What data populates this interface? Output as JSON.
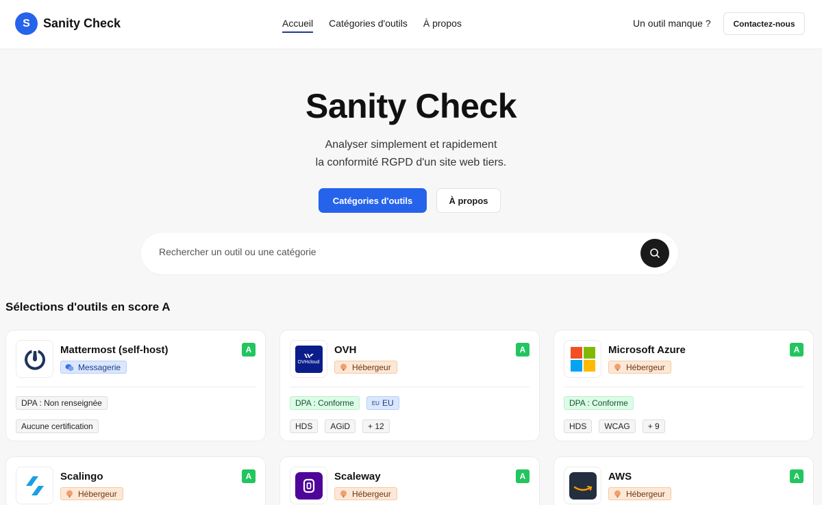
{
  "header": {
    "brand_initial": "S",
    "brand_name": "Sanity Check",
    "nav": [
      "Accueil",
      "Catégories d'outils",
      "À propos"
    ],
    "missing_tool": "Un outil manque ?",
    "contact_button": "Contactez-nous"
  },
  "hero": {
    "title": "Sanity Check",
    "subtitle_line1": "Analyser simplement et rapidement",
    "subtitle_line2": "la conformité RGPD d'un site web tiers.",
    "primary_button": "Catégories d'outils",
    "secondary_button": "À propos"
  },
  "search": {
    "placeholder": "Rechercher un outil ou une catégorie"
  },
  "section_title": "Sélections d'outils en score A",
  "colors": {
    "accent": "#2563eb",
    "score_a": "#22c55e",
    "dark": "#1a1a1a"
  },
  "cards": [
    {
      "name": "Mattermost (self-host)",
      "category": "Messagerie",
      "category_icon": "chat-bubbles-icon",
      "logo": "mattermost-logo",
      "score": "A",
      "chips_row1": [
        "DPA : Non renseignée"
      ],
      "chips_row2": [
        "Aucune certification"
      ]
    },
    {
      "name": "OVH",
      "category": "Hébergeur",
      "category_icon": "server-icon",
      "logo": "ovhcloud-logo",
      "logo_text": "OVHcloud",
      "score": "A",
      "chips_row1": [
        "DPA : Conforme",
        "EU"
      ],
      "eu_prefix": "EU",
      "chips_row2": [
        "HDS",
        "AGiD",
        "+ 12"
      ]
    },
    {
      "name": "Microsoft Azure",
      "category": "Hébergeur",
      "category_icon": "server-icon",
      "logo": "microsoft-logo",
      "score": "A",
      "chips_row1": [
        "DPA : Conforme"
      ],
      "chips_row2": [
        "HDS",
        "WCAG",
        "+ 9"
      ]
    },
    {
      "name": "Scalingo",
      "category": "Hébergeur",
      "category_icon": "server-icon",
      "logo": "scalingo-logo",
      "score": "A"
    },
    {
      "name": "Scaleway",
      "category": "Hébergeur",
      "category_icon": "server-icon",
      "logo": "scaleway-logo",
      "score": "A"
    },
    {
      "name": "AWS",
      "category": "Hébergeur",
      "category_icon": "server-icon",
      "logo": "aws-logo",
      "score": "A"
    }
  ]
}
